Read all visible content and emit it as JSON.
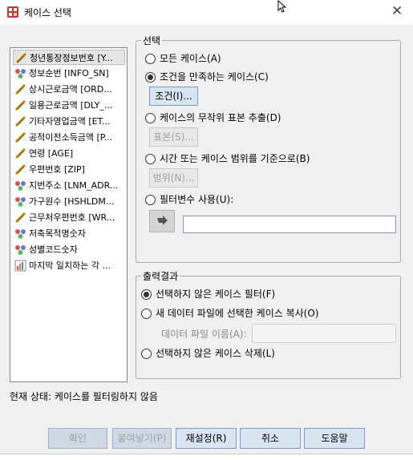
{
  "window": {
    "title": "케이스 선택",
    "close_icon": "close-icon"
  },
  "variables": [
    {
      "label": "청년통장정보번호 [Y...",
      "icon": "ruler-scale-icon"
    },
    {
      "label": "정보순번 [INFO_SN]",
      "icon": "nominal-icon"
    },
    {
      "label": "상시근로금액 [ORD...",
      "icon": "ruler-scale-icon"
    },
    {
      "label": "일용근로금액 [DLY_...",
      "icon": "ruler-scale-icon"
    },
    {
      "label": "기타자영업금액 [ET...",
      "icon": "ruler-scale-icon"
    },
    {
      "label": "공적이전소득금액 [P...",
      "icon": "ruler-scale-icon"
    },
    {
      "label": "연령 [AGE]",
      "icon": "ruler-scale-icon"
    },
    {
      "label": "우편번호 [ZIP]",
      "icon": "ruler-scale-icon"
    },
    {
      "label": "지번주소 [LNM_ADR...",
      "icon": "nominal-icon"
    },
    {
      "label": "가구원수 [HSHLDM...",
      "icon": "nominal-icon"
    },
    {
      "label": "근무처우편번호 [WR...",
      "icon": "ruler-scale-icon"
    },
    {
      "label": "저축목적명숫자",
      "icon": "nominal-icon"
    },
    {
      "label": "성별코드숫자",
      "icon": "nominal-icon"
    },
    {
      "label": "마지막 일치하는 각 ...",
      "icon": "bar-chart-icon"
    }
  ],
  "selection": {
    "legend": "선택",
    "all_cases": "모든 케이스(A)",
    "if_condition": "조건을 만족하는 케이스(C)",
    "if_button": "조건(I)...",
    "random_sample": "케이스의 무작위 표본 추출(D)",
    "sample_button": "표본(S)...",
    "based_on_range": "시간 또는 케이스 범위를 기준으로(B)",
    "range_button": "범위(N)...",
    "filter_variable": "필터변수 사용(U):",
    "filter_value": ""
  },
  "output": {
    "legend": "출력결과",
    "filter_out": "선택하지 않은 케이스 필터(F)",
    "copy_to_new": "새 데이터 파일에 선택한 케이스 복사(O)",
    "dataset_name_label": "데이터 파일 이름(A):",
    "dataset_name_value": "",
    "delete_unselected": "선택하지 않은 케이스 삭제(L)"
  },
  "status": "현재 상태: 케이스를 필터링하지 않음",
  "buttons": {
    "ok": "확인",
    "paste": "붙여넣기(P)",
    "reset": "재설정(R)",
    "cancel": "취소",
    "help": "도움말"
  }
}
